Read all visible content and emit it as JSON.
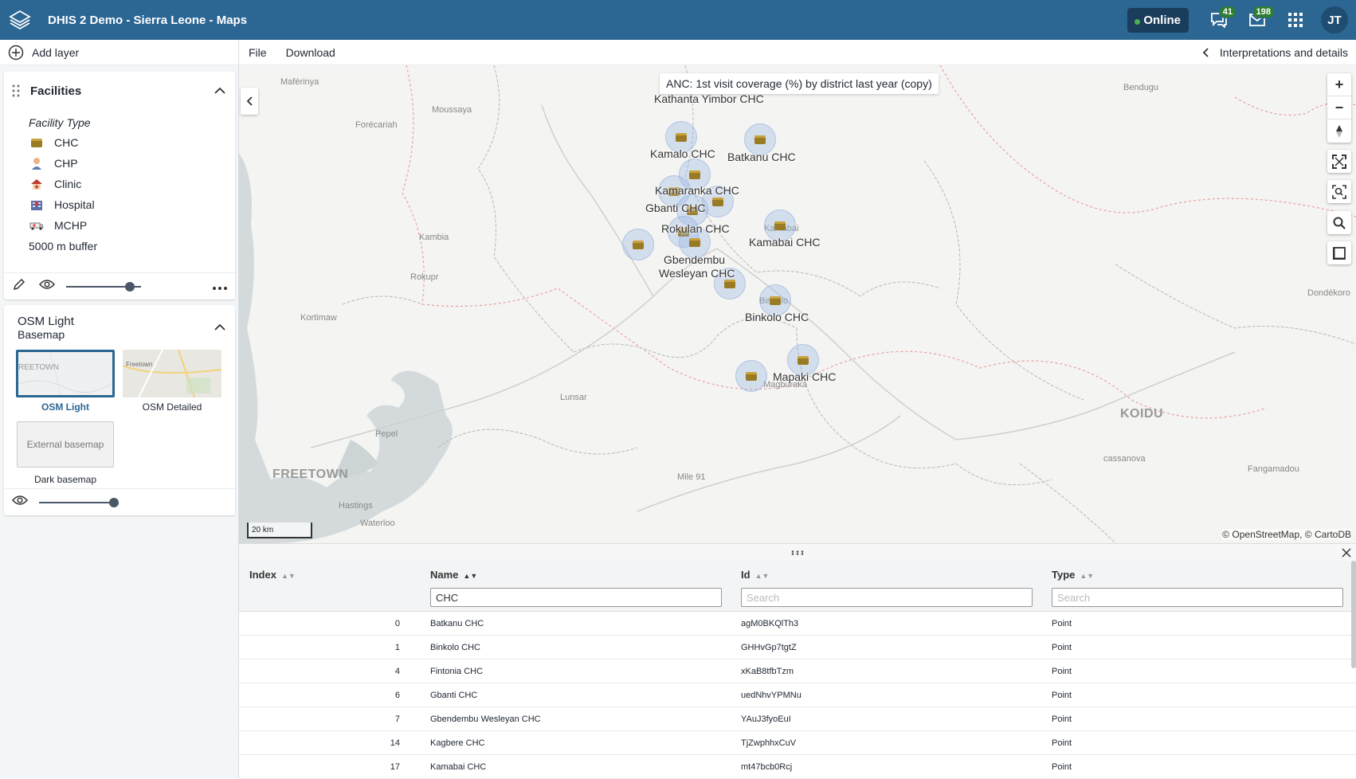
{
  "header": {
    "app_title": "DHIS 2 Demo - Sierra Leone - Maps",
    "online_label": "Online",
    "interpretations_count": "41",
    "messages_count": "198",
    "user_initials": "JT"
  },
  "sidebar": {
    "add_layer_label": "Add layer",
    "facilities": {
      "title": "Facilities",
      "legend_title": "Facility Type",
      "items": [
        {
          "label": "CHC",
          "icon": "chc-icon"
        },
        {
          "label": "CHP",
          "icon": "chp-icon"
        },
        {
          "label": "Clinic",
          "icon": "clinic-icon"
        },
        {
          "label": "Hospital",
          "icon": "hospital-icon"
        },
        {
          "label": "MCHP",
          "icon": "mchp-icon"
        }
      ],
      "buffer_label": "5000 m buffer",
      "opacity": 0.85
    },
    "basemap": {
      "title": "OSM Light",
      "subtitle": "Basemap",
      "options": [
        {
          "label": "OSM Light",
          "thumb_text": "REETOWN",
          "selected": true
        },
        {
          "label": "OSM Detailed",
          "thumb_text": "Freetown",
          "selected": false
        },
        {
          "label": "Dark basemap",
          "thumb_text": "External basemap",
          "selected": false
        }
      ],
      "opacity": 1.0
    }
  },
  "topbar": {
    "file_label": "File",
    "download_label": "Download",
    "interpretations_label": "Interpretations and details"
  },
  "map": {
    "title": "ANC: 1st visit coverage (%) by district last year (copy)",
    "facility_labels": [
      "Kathanta Yimbor CHC",
      "Kamalo CHC",
      "Batkanu CHC",
      "Kamaranka CHC",
      "Gbanti CHC",
      "Rokulan CHC",
      "Kamabai CHC",
      "Gbendembu",
      "Wesleyan CHC",
      "Binkolo CHC",
      "Mapaki CHC"
    ],
    "places": [
      "Maférinya",
      "Moussaya",
      "Forécariah",
      "Kambia",
      "Rokupr",
      "Kortimaw",
      "Lunsar",
      "Pepel",
      "FREETOWN",
      "Hastings",
      "Waterloo",
      "Mile 91",
      "Magburaka",
      "Bendugu",
      "Dondékoro",
      "KOIDU",
      "cassanova",
      "Fangamadou",
      "Kamabai",
      "Binkolo"
    ],
    "scale_label": "20 km",
    "attribution": "© OpenStreetMap, © CartoDB",
    "colors": {
      "water": "#d4dadc",
      "boundary": "#e8a0a0",
      "road": "#c9c9c9"
    }
  },
  "table": {
    "columns": [
      {
        "label": "Index"
      },
      {
        "label": "Name",
        "filter_value": "CHC"
      },
      {
        "label": "Id",
        "filter_placeholder": "Search"
      },
      {
        "label": "Type",
        "filter_placeholder": "Search"
      }
    ],
    "rows": [
      {
        "index": "0",
        "name": "Batkanu CHC",
        "id": "agM0BKQlTh3",
        "type": "Point"
      },
      {
        "index": "1",
        "name": "Binkolo CHC",
        "id": "GHHvGp7tgtZ",
        "type": "Point"
      },
      {
        "index": "4",
        "name": "Fintonia CHC",
        "id": "xKaB8tfbTzm",
        "type": "Point"
      },
      {
        "index": "6",
        "name": "Gbanti CHC",
        "id": "uedNhvYPMNu",
        "type": "Point"
      },
      {
        "index": "7",
        "name": "Gbendembu Wesleyan CHC",
        "id": "YAuJ3fyoEuI",
        "type": "Point"
      },
      {
        "index": "14",
        "name": "Kagbere CHC",
        "id": "TjZwphhxCuV",
        "type": "Point"
      },
      {
        "index": "17",
        "name": "Kamabai CHC",
        "id": "mt47bcb0Rcj",
        "type": "Point"
      }
    ]
  }
}
